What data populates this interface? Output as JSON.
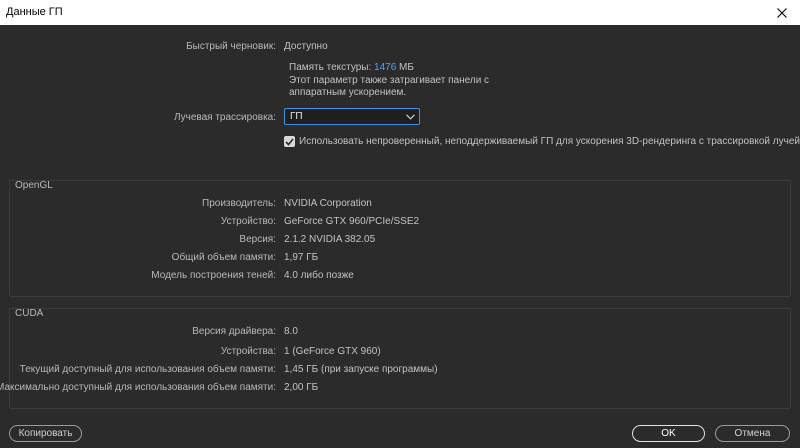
{
  "window": {
    "title": "Данные ГП",
    "close_icon": "close-icon"
  },
  "mercury": {
    "label": "Быстрый черновик:",
    "value": "Доступно",
    "texture_label": "Память текстуры:",
    "texture_value": "1476",
    "texture_unit": "МБ",
    "note_line1": "Этот параметр также затрагивает панели с",
    "note_line2": "аппаратным ускорением."
  },
  "raytrace": {
    "label": "Лучевая трассировка:",
    "selected": "ГП",
    "checkbox_checked": true,
    "checkbox_label": "Использовать непроверенный, неподдерживаемый ГП для ускорения 3D-рендеринга с трассировкой лучей CUDA"
  },
  "opengl": {
    "title": "OpenGL",
    "rows": [
      {
        "label": "Производитель:",
        "value": "NVIDIA Corporation"
      },
      {
        "label": "Устройство:",
        "value": "GeForce GTX 960/PCIe/SSE2"
      },
      {
        "label": "Версия:",
        "value": "2.1.2 NVIDIA 382.05"
      },
      {
        "label": "Общий объем памяти:",
        "value": "1,97 ГБ"
      },
      {
        "label": "Модель построения теней:",
        "value": "4.0 либо позже"
      }
    ]
  },
  "cuda": {
    "title": "CUDA",
    "rows": [
      {
        "label": "Версия драйвера:",
        "value": "8.0"
      },
      {
        "label": "Устройства:",
        "value": "1 (GeForce GTX 960)"
      },
      {
        "label": "Текущий доступный для использования объем памяти:",
        "value": "1,45 ГБ (при запуске программы)"
      },
      {
        "label": "Максимально доступный для использования объем памяти:",
        "value": "2,00 ГБ"
      }
    ]
  },
  "buttons": {
    "copy": "Копировать",
    "ok": "OK",
    "cancel": "Отмена"
  }
}
